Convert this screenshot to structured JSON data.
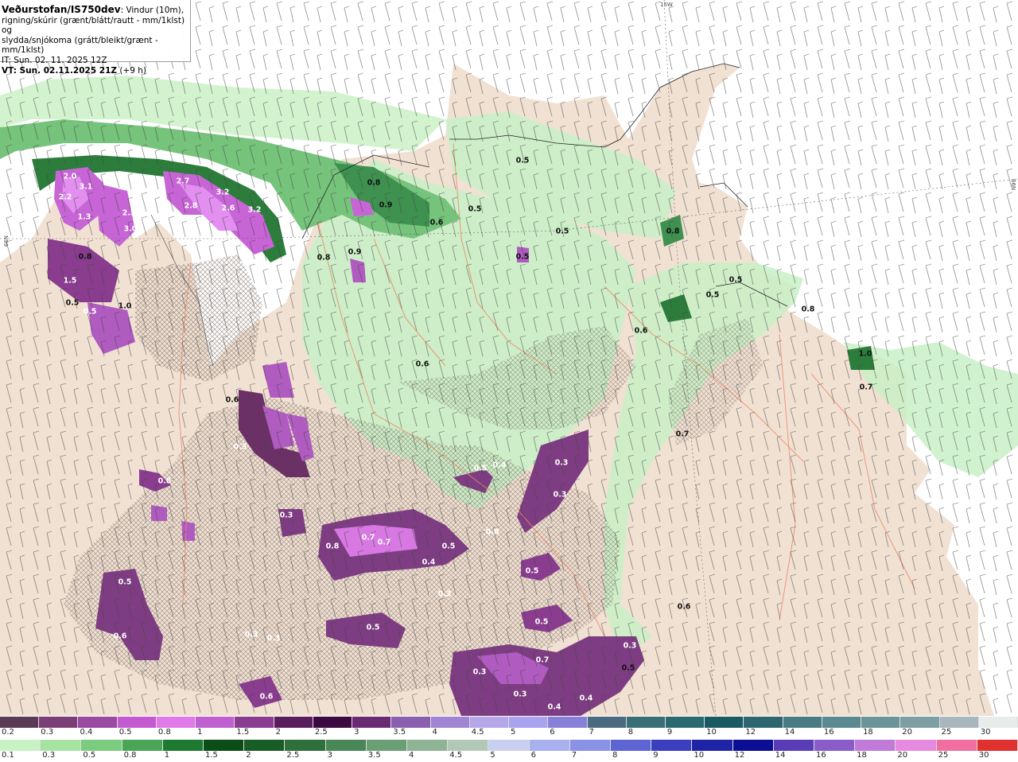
{
  "header": {
    "title": "Veðurstofan/IS750dev",
    "desc_1": ": Vindur (10m),",
    "desc_2": "rigning/skúrir (grænt/blátt/rautt - mm/1klst) og",
    "desc_3": "slydda/snjókoma (grátt/bleikt/grænt - mm/1klst)",
    "it": "IT: Sun. 02. 11. 2025 12Z",
    "vt": "VT: Sun. 02.11.2025 21Z",
    "vt_offset": " (+9 h)"
  },
  "grid_labels": {
    "top": "15W",
    "right": "66N",
    "left": "N99"
  },
  "map_labels": [
    "2.0",
    "3.1",
    "2.2",
    "1.3",
    "2.5",
    "3.0",
    "2.7",
    "3.2",
    "2.6",
    "3.2",
    "2.8",
    "0.5",
    "0.8",
    "0.9",
    "0.6",
    "0.5",
    "0.5",
    "0.8",
    "0.8",
    "0.9",
    "0.5",
    "0.5",
    "0.8",
    "0.5",
    "0.5",
    "0.6",
    "1.0",
    "0.8",
    "1.0",
    "0.7",
    "0.6",
    "0.6",
    "0.5",
    "0.4",
    "0.3",
    "0.7",
    "0.8",
    "0.7",
    "0.6",
    "0.5",
    "0.4",
    "0.5",
    "0.3",
    "0.5",
    "0.3",
    "0.5",
    "0.3",
    "0.3",
    "0.5",
    "0.6",
    "0.7",
    "0.3",
    "0.3",
    "0.4",
    "0.4",
    "0.6",
    "0.3",
    "0.5",
    "0.3",
    "0.6",
    "0.5",
    "0.8",
    "1.5",
    "0.7",
    "0.3"
  ],
  "legend_snow": {
    "ticks": [
      "0.2",
      "0.3",
      "0.4",
      "0.5",
      "0.8",
      "1",
      "1.5",
      "2",
      "2.5",
      "3",
      "3.5",
      "4",
      "4.5",
      "5",
      "6",
      "7",
      "8",
      "9",
      "10",
      "12",
      "14",
      "16",
      "18",
      "20",
      "25",
      "30"
    ],
    "colors": [
      "#5b3a55",
      "#7b3f78",
      "#9a4aa0",
      "#c45ad0",
      "#e07ae8",
      "#c060d0",
      "#8a3d90",
      "#5a1e5e",
      "#3a0a40",
      "#6a2a72",
      "#8a5fb0",
      "#9f85d4",
      "#b5a6e8",
      "#a9a3f0",
      "#8880d8",
      "#4a6a80",
      "#3a6e75",
      "#2a6a6e",
      "#1a5a62",
      "#2e6670",
      "#4a7a82",
      "#5a8a8f",
      "#6a9498",
      "#7d9ea3",
      "#a8b6bd",
      "#e8eceb"
    ]
  },
  "legend_rain": {
    "ticks": [
      "0.1",
      "0.3",
      "0.5",
      "0.8",
      "1",
      "1.5",
      "2",
      "2.5",
      "3",
      "3.5",
      "4",
      "4.5",
      "5",
      "6",
      "7",
      "8",
      "9",
      "10",
      "12",
      "14",
      "16",
      "18",
      "20",
      "25",
      "30"
    ],
    "colors": [
      "#c9f2c4",
      "#a6e3a2",
      "#7bcc7e",
      "#4aa556",
      "#1f7a31",
      "#0a4d17",
      "#185c26",
      "#2f6f3c",
      "#4a8757",
      "#6a9f73",
      "#8fb495",
      "#b2c8b6",
      "#c8cff0",
      "#a8b0ee",
      "#8a92e6",
      "#5d64d4",
      "#3a3fc0",
      "#1e24a8",
      "#0b0f96",
      "#5a3cb8",
      "#8a5cc8",
      "#c07ad8",
      "#e68ae0",
      "#f06fa0",
      "#e03030"
    ]
  }
}
